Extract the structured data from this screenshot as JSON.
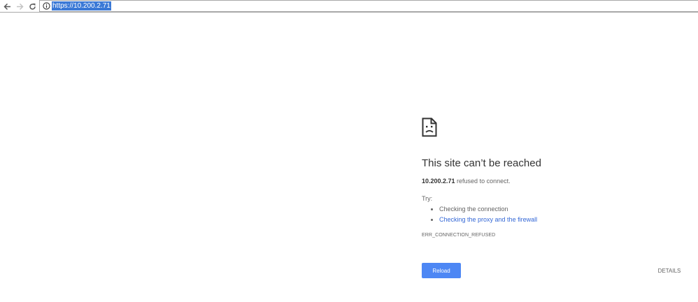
{
  "toolbar": {
    "back_icon": "arrow-left-icon",
    "forward_icon": "arrow-right-icon",
    "reload_icon": "reload-icon",
    "info_icon": "info-icon",
    "url": "https://10.200.2.71"
  },
  "error_page": {
    "icon": "sad-page-icon",
    "heading": "This site can’t be reached",
    "host": "10.200.2.71",
    "summary_suffix": " refused to connect.",
    "try_label": "Try:",
    "suggestions": [
      {
        "label": "Checking the connection",
        "is_link": false
      },
      {
        "label": "Checking the proxy and the firewall",
        "is_link": true
      }
    ],
    "error_code": "ERR_CONNECTION_REFUSED",
    "reload_label": "Reload",
    "details_label": "DETAILS"
  },
  "colors": {
    "primary_button": "#4d87f4",
    "link": "#3367d6",
    "url_highlight": "#3b79d6"
  }
}
